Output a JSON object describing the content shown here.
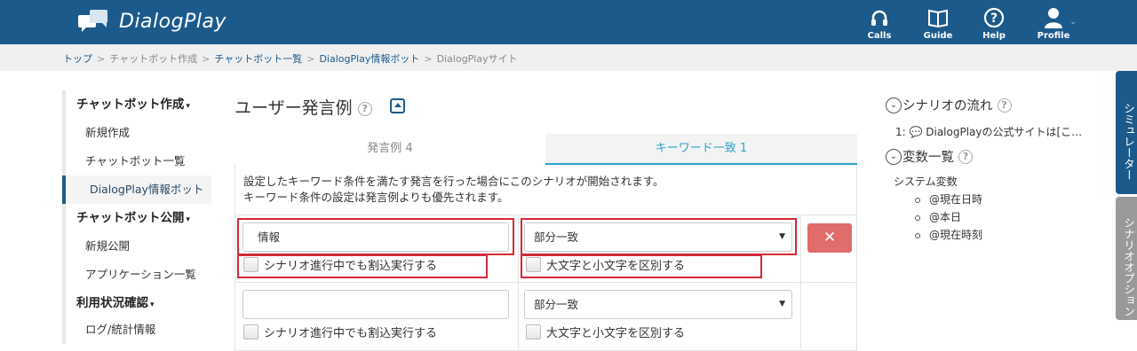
{
  "app": {
    "name": "DialogPlay",
    "nav": [
      {
        "label": "Calls",
        "icon": "headset-icon"
      },
      {
        "label": "Guide",
        "icon": "book-icon"
      },
      {
        "label": "Help",
        "icon": "question-icon"
      },
      {
        "label": "Profile",
        "icon": "user-icon"
      }
    ]
  },
  "breadcrumb": [
    "トップ",
    "チャットボット作成",
    "チャットボット一覧",
    "DialogPlay情報ボット",
    "DialogPlayサイト"
  ],
  "sidebar": {
    "sections": [
      {
        "label": "チャットボット作成",
        "items": [
          "新規作成",
          "チャットボット一覧",
          "DialogPlay情報ボット"
        ]
      },
      {
        "label": "チャットボット公開",
        "items": [
          "新規公開",
          "アプリケーション一覧"
        ]
      },
      {
        "label": "利用状況確認",
        "items": [
          "ログ/統計情報"
        ]
      }
    ],
    "active_item": "DialogPlay情報ボット"
  },
  "main": {
    "title": "ユーザー発言例",
    "tabs": [
      {
        "label": "発言例 4",
        "active": false
      },
      {
        "label": "キーワード一致 1",
        "active": true
      }
    ],
    "description_line1": "設定したキーワード条件を満たす発言を行った場合にこのシナリオが開始されます。",
    "description_line2": "キーワード条件の設定は発言例よりも優先されます。",
    "rows": [
      {
        "keyword": "情報",
        "placeholder": "",
        "match": "部分一致",
        "interrupt_label": "シナリオ進行中でも割込実行する",
        "case_label": "大文字と小文字を区別する",
        "interrupt_checked": false,
        "case_checked": false
      },
      {
        "keyword": "",
        "placeholder": "",
        "match": "部分一致",
        "interrupt_label": "シナリオ進行中でも割込実行する",
        "case_label": "大文字と小文字を区別する",
        "interrupt_checked": false,
        "case_checked": false
      }
    ],
    "delete_label": "✕"
  },
  "right": {
    "flow_title": "シナリオの流れ",
    "flow_item": "1: 💬 DialogPlayの公式サイトは[こ…",
    "vars_title": "変数一覧",
    "system_vars_label": "システム変数",
    "system_vars": [
      "@現在日時",
      "@本日",
      "@現在時刻"
    ]
  },
  "side_tabs": [
    "シミュレーター",
    "シナリオオプション"
  ],
  "colors": {
    "header": "#1d5a8c",
    "accent": "#2aa4c9",
    "delete": "#e06c6c",
    "highlight": "#d42a36"
  }
}
